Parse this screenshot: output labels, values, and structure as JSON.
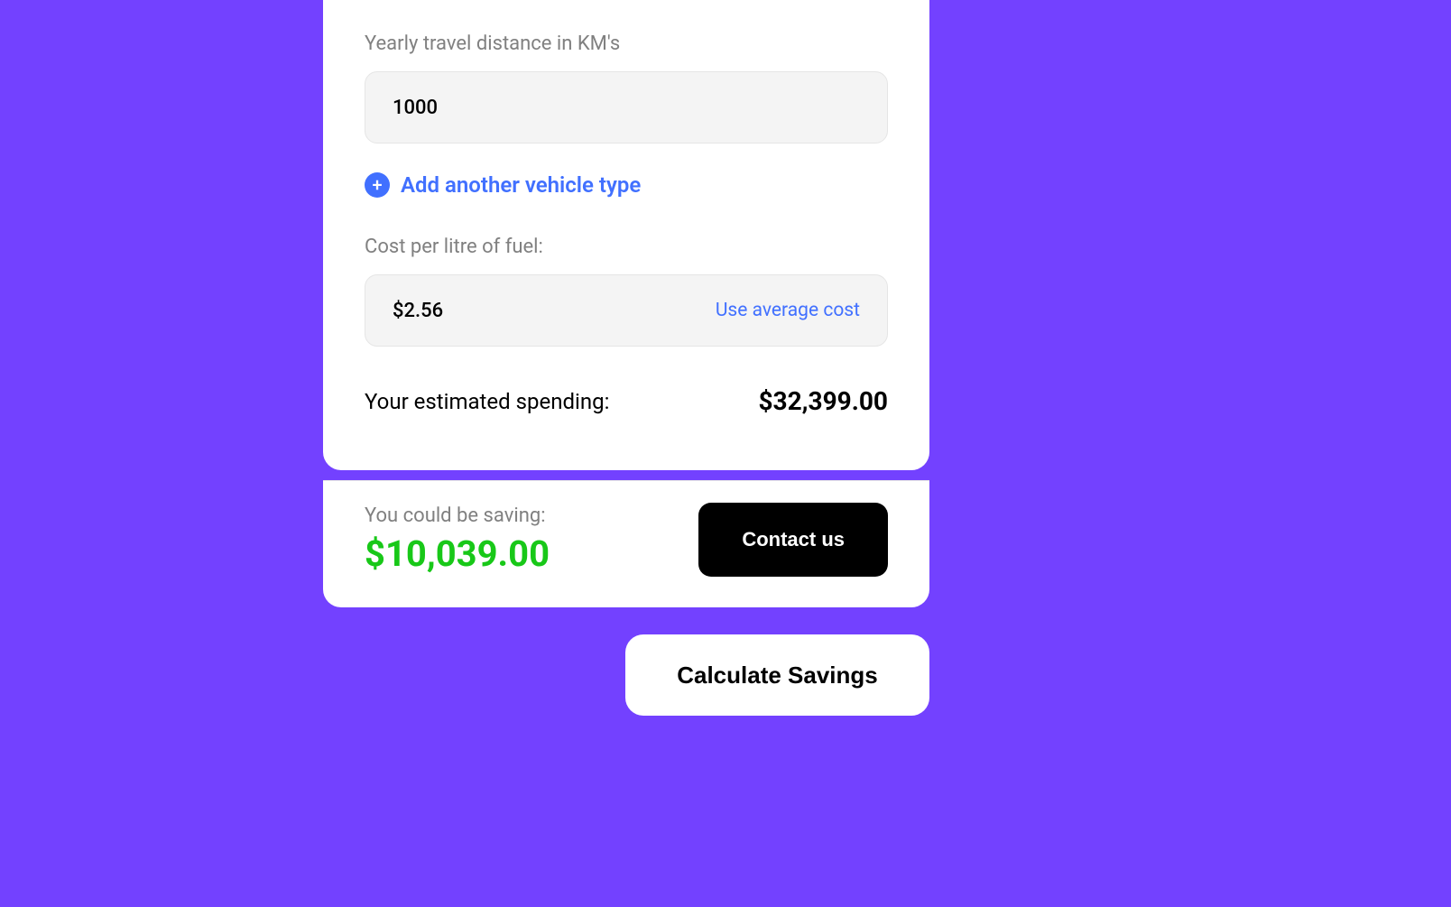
{
  "distance": {
    "label": "Yearly travel distance in KM's",
    "value": "1000"
  },
  "add_vehicle": {
    "label": "Add another vehicle type"
  },
  "fuel_cost": {
    "label": "Cost per litre of fuel:",
    "value": "$2.56",
    "action": "Use average cost"
  },
  "spending": {
    "label": "Your estimated spending:",
    "value": "$32,399.00"
  },
  "saving": {
    "label": "You could be saving:",
    "value": "$10,039.00"
  },
  "contact_btn": "Contact us",
  "calculate_btn": "Calculate Savings"
}
